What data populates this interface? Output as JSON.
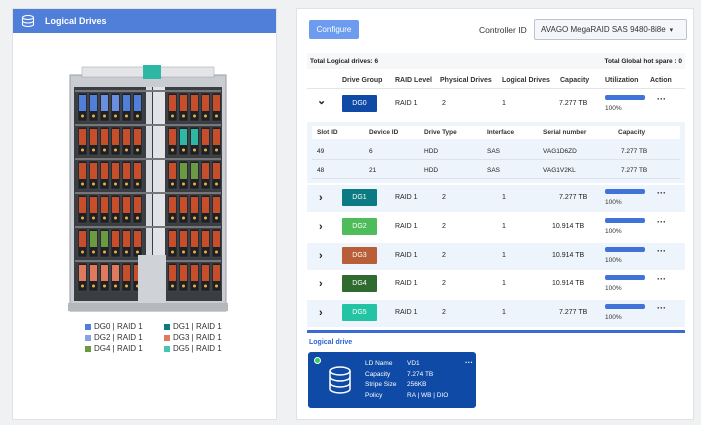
{
  "left_panel": {
    "title": "Logical Drives",
    "legend": [
      {
        "label": "DG0 | RAID 1",
        "color": "#4f7fd9"
      },
      {
        "label": "DG1 | RAID 1",
        "color": "#0b7a82"
      },
      {
        "label": "DG2 | RAID 1",
        "color": "#8aa0e6"
      },
      {
        "label": "DG3 | RAID 1",
        "color": "#e07a5f"
      },
      {
        "label": "DG4 | RAID 1",
        "color": "#6a9b43"
      },
      {
        "label": "DG5 | RAID 1",
        "color": "#43c7b0"
      }
    ]
  },
  "toolbar": {
    "configure_label": "Configure",
    "controller_label": "Controller ID",
    "controller_value": "AVAGO MegaRAID SAS 9480-8i8e"
  },
  "summary": {
    "total_logical": "Total Logical drives: 6",
    "total_hot_spare": "Total Global hot spare : 0"
  },
  "table": {
    "headers": [
      "Drive Group",
      "RAID Level",
      "Physical Drives",
      "Logical Drives",
      "Capacity",
      "Utilization",
      "Action"
    ],
    "rows": [
      {
        "group": "DG0",
        "color": "#0f4aa6",
        "raid": "RAID 1",
        "physical": "2",
        "logical": "1",
        "capacity": "7.277 TB",
        "utilization": "100%",
        "utilization_frac": 1.0,
        "expanded": true
      },
      {
        "group": "DG1",
        "color": "#0b7a82",
        "raid": "RAID 1",
        "physical": "2",
        "logical": "1",
        "capacity": "7.277 TB",
        "utilization": "100%",
        "utilization_frac": 1.0,
        "expanded": false
      },
      {
        "group": "DG2",
        "color": "#4ebc5a",
        "raid": "RAID 1",
        "physical": "2",
        "logical": "1",
        "capacity": "10.914 TB",
        "utilization": "100%",
        "utilization_frac": 1.0,
        "expanded": false
      },
      {
        "group": "DG3",
        "color": "#b85f3a",
        "raid": "RAID 1",
        "physical": "2",
        "logical": "1",
        "capacity": "10.914 TB",
        "utilization": "100%",
        "utilization_frac": 1.0,
        "expanded": false
      },
      {
        "group": "DG4",
        "color": "#2f6b2f",
        "raid": "RAID 1",
        "physical": "2",
        "logical": "1",
        "capacity": "10.914 TB",
        "utilization": "100%",
        "utilization_frac": 1.0,
        "expanded": false
      },
      {
        "group": "DG5",
        "color": "#22c4a4",
        "raid": "RAID 1",
        "physical": "2",
        "logical": "1",
        "capacity": "7.277 TB",
        "utilization": "100%",
        "utilization_frac": 1.0,
        "expanded": false
      }
    ],
    "action_glyph": "···",
    "expand_glyph_open": "⌄",
    "expand_glyph_closed": "›"
  },
  "sub_table": {
    "headers": [
      "Slot ID",
      "Device ID",
      "Drive Type",
      "Interface",
      "Serial number",
      "Capacity"
    ],
    "rows": [
      [
        "49",
        "6",
        "HDD",
        "SAS",
        "VAG1D6ZD",
        "7.277 TB"
      ],
      [
        "48",
        "21",
        "HDD",
        "SAS",
        "VAG1V2KL",
        "7.277 TB"
      ]
    ]
  },
  "logical_drive": {
    "section_title": "Logical drive",
    "labels": [
      "LD Name",
      "Capacity",
      "Stripe Size",
      "Policy"
    ],
    "values": [
      "VD1",
      "7.274 TB",
      "256KB",
      "RA | WB | DIO"
    ],
    "action_glyph": "···"
  }
}
